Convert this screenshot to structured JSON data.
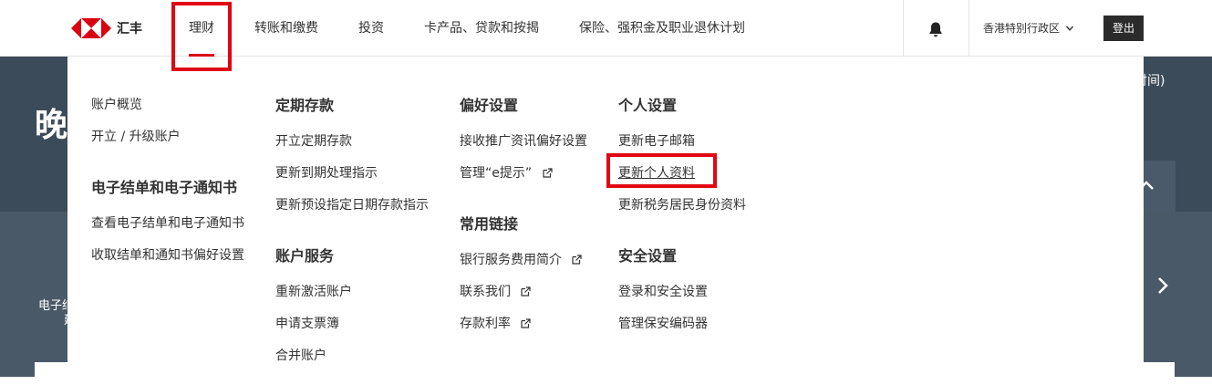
{
  "header": {
    "logo_text": "汇丰",
    "nav": [
      "理财",
      "转账和缴费",
      "投资",
      "卡产品、贷款和按揭",
      "保险、强积金及职业退休计划"
    ],
    "region": "香港特别行政区",
    "logout": "登出"
  },
  "background": {
    "greeting": "晚",
    "time_hint": "时间)",
    "estatement_fragment": "电子结",
    "fragment2": "建"
  },
  "menu": {
    "col1": {
      "items": [
        "账户概览",
        "开立 / 升级账户"
      ],
      "heading": "电子结单和电子通知书",
      "items2": [
        "查看电子结单和电子通知书",
        "收取结单和通知书偏好设置"
      ]
    },
    "col2": {
      "heading1": "定期存款",
      "items1": [
        "开立定期存款",
        "更新到期处理指示",
        "更新预设指定日期存款指示"
      ],
      "heading2": "账户服务",
      "items2": [
        "重新激活账户",
        "申请支票簿",
        "合并账户"
      ]
    },
    "col3": {
      "heading1": "偏好设置",
      "items1": [
        "接收推广资讯偏好设置",
        "管理“e提示”"
      ],
      "heading2": "常用链接",
      "items2": [
        "银行服务费用简介",
        "联系我们",
        "存款利率"
      ]
    },
    "col4": {
      "heading1": "个人设置",
      "items1": [
        "更新电子邮箱",
        "更新个人资料",
        "更新税务居民身份资料"
      ],
      "heading2": "安全设置",
      "items2": [
        "登录和安全设置",
        "管理保安编码器"
      ]
    }
  },
  "colors": {
    "brand_red": "#db0011",
    "highlight_red": "#e10613",
    "hero_bg": "#3c4b59",
    "logout_bg": "#2b2b2b"
  },
  "icons": [
    "hsbc-hexagon-logo",
    "bell-icon",
    "chevron-down-icon",
    "external-link-icon",
    "chevron-up-icon",
    "chevron-right-icon"
  ]
}
